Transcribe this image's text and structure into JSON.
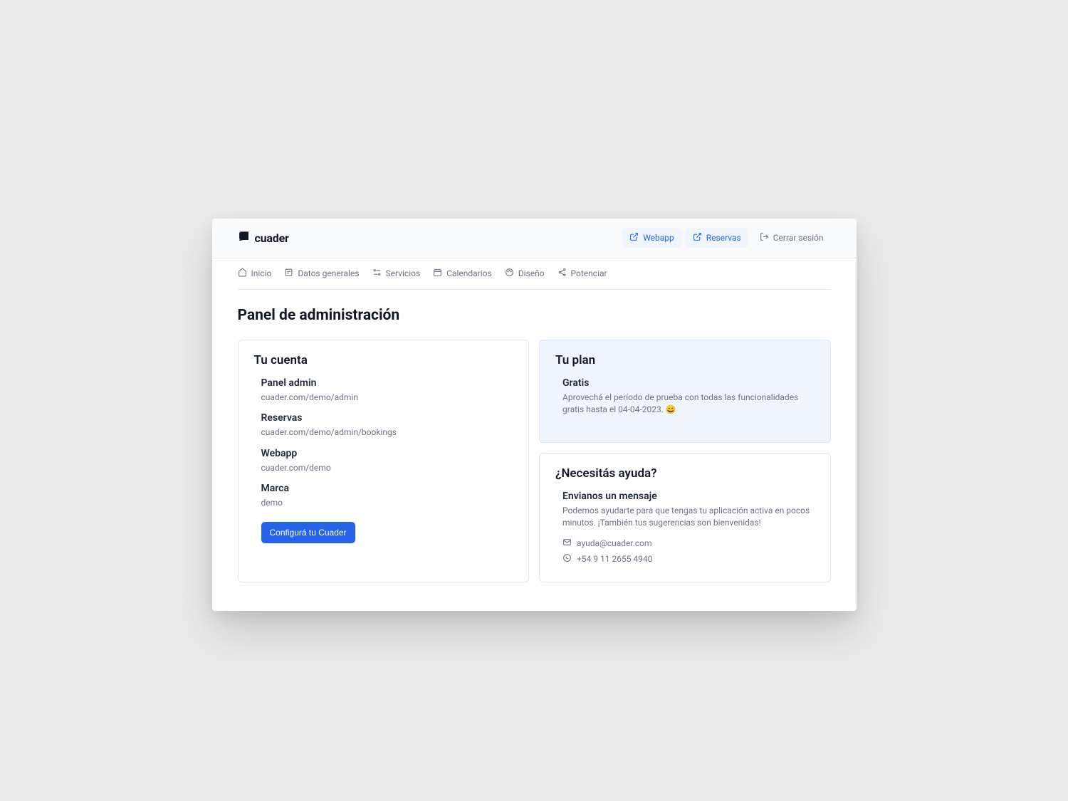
{
  "brand": "cuader",
  "top_actions": {
    "webapp": "Webapp",
    "reservas": "Reservas",
    "logout": "Cerrar sesión"
  },
  "tabs": {
    "inicio": "Inicio",
    "datos": "Datos generales",
    "servicios": "Servicios",
    "calendarios": "Calendarios",
    "diseno": "Diseño",
    "potenciar": "Potenciar"
  },
  "page_title": "Panel de administración",
  "account": {
    "title": "Tu cuenta",
    "items": {
      "panel": {
        "label": "Panel admin",
        "url": "cuader.com/demo/admin"
      },
      "reservas": {
        "label": "Reservas",
        "url": "cuader.com/demo/admin/bookings"
      },
      "webapp": {
        "label": "Webapp",
        "url": "cuader.com/demo"
      },
      "marca": {
        "label": "Marca",
        "value": "demo"
      }
    },
    "cta": "Configurá tu Cuader"
  },
  "plan": {
    "title": "Tu plan",
    "name": "Gratis",
    "desc": "Aprovechá el período de prueba con todas las funcionalidades gratis hasta el 04-04-2023. 😄"
  },
  "help": {
    "title": "¿Necesitás ayuda?",
    "heading": "Envianos un mensaje",
    "desc": "Podemos ayudarte para que tengas tu aplicación activa en pocos minutos. ¡También tus sugerencias son bienvenidas!",
    "email": "ayuda@cuader.com",
    "phone": "+54 9 11 2655 4940"
  }
}
